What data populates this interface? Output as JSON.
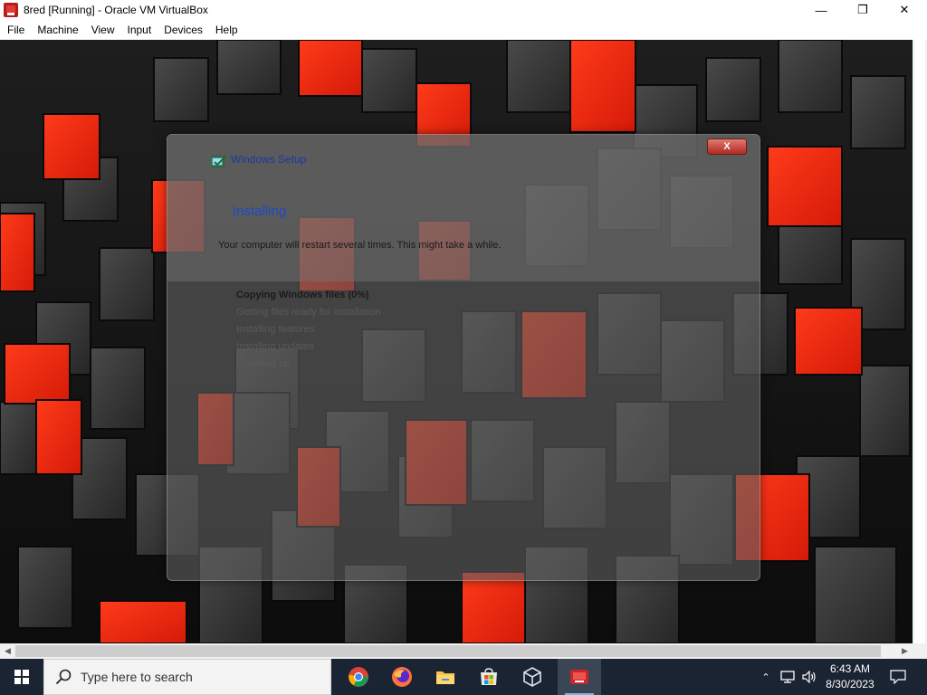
{
  "window": {
    "title": "8red [Running] - Oracle VM VirtualBox",
    "controls": {
      "minimize": "—",
      "maximize": "❐",
      "close": "✕"
    }
  },
  "menu": [
    "File",
    "Machine",
    "View",
    "Input",
    "Devices",
    "Help"
  ],
  "setup": {
    "title": "Windows Setup",
    "close_label": "X",
    "heading": "Installing",
    "subtext": "Your computer will restart several times. This might take a while.",
    "steps": [
      "Copying Windows files (0%)",
      "Getting files ready for installation",
      "Installing features",
      "Installing updates",
      "Finishing up"
    ]
  },
  "taskbar": {
    "search_placeholder": "Type here to search",
    "apps": [
      "chrome-icon",
      "firefox-icon",
      "file-explorer-icon",
      "microsoft-store-icon",
      "virtualbox-icon",
      "virtualbox-vm-icon"
    ],
    "time": "6:43 AM",
    "date": "8/30/2023"
  },
  "colors": {
    "accent_red": "#ff2a10",
    "taskbar": "#1b2433",
    "setup_heading": "#1a4ac8"
  }
}
